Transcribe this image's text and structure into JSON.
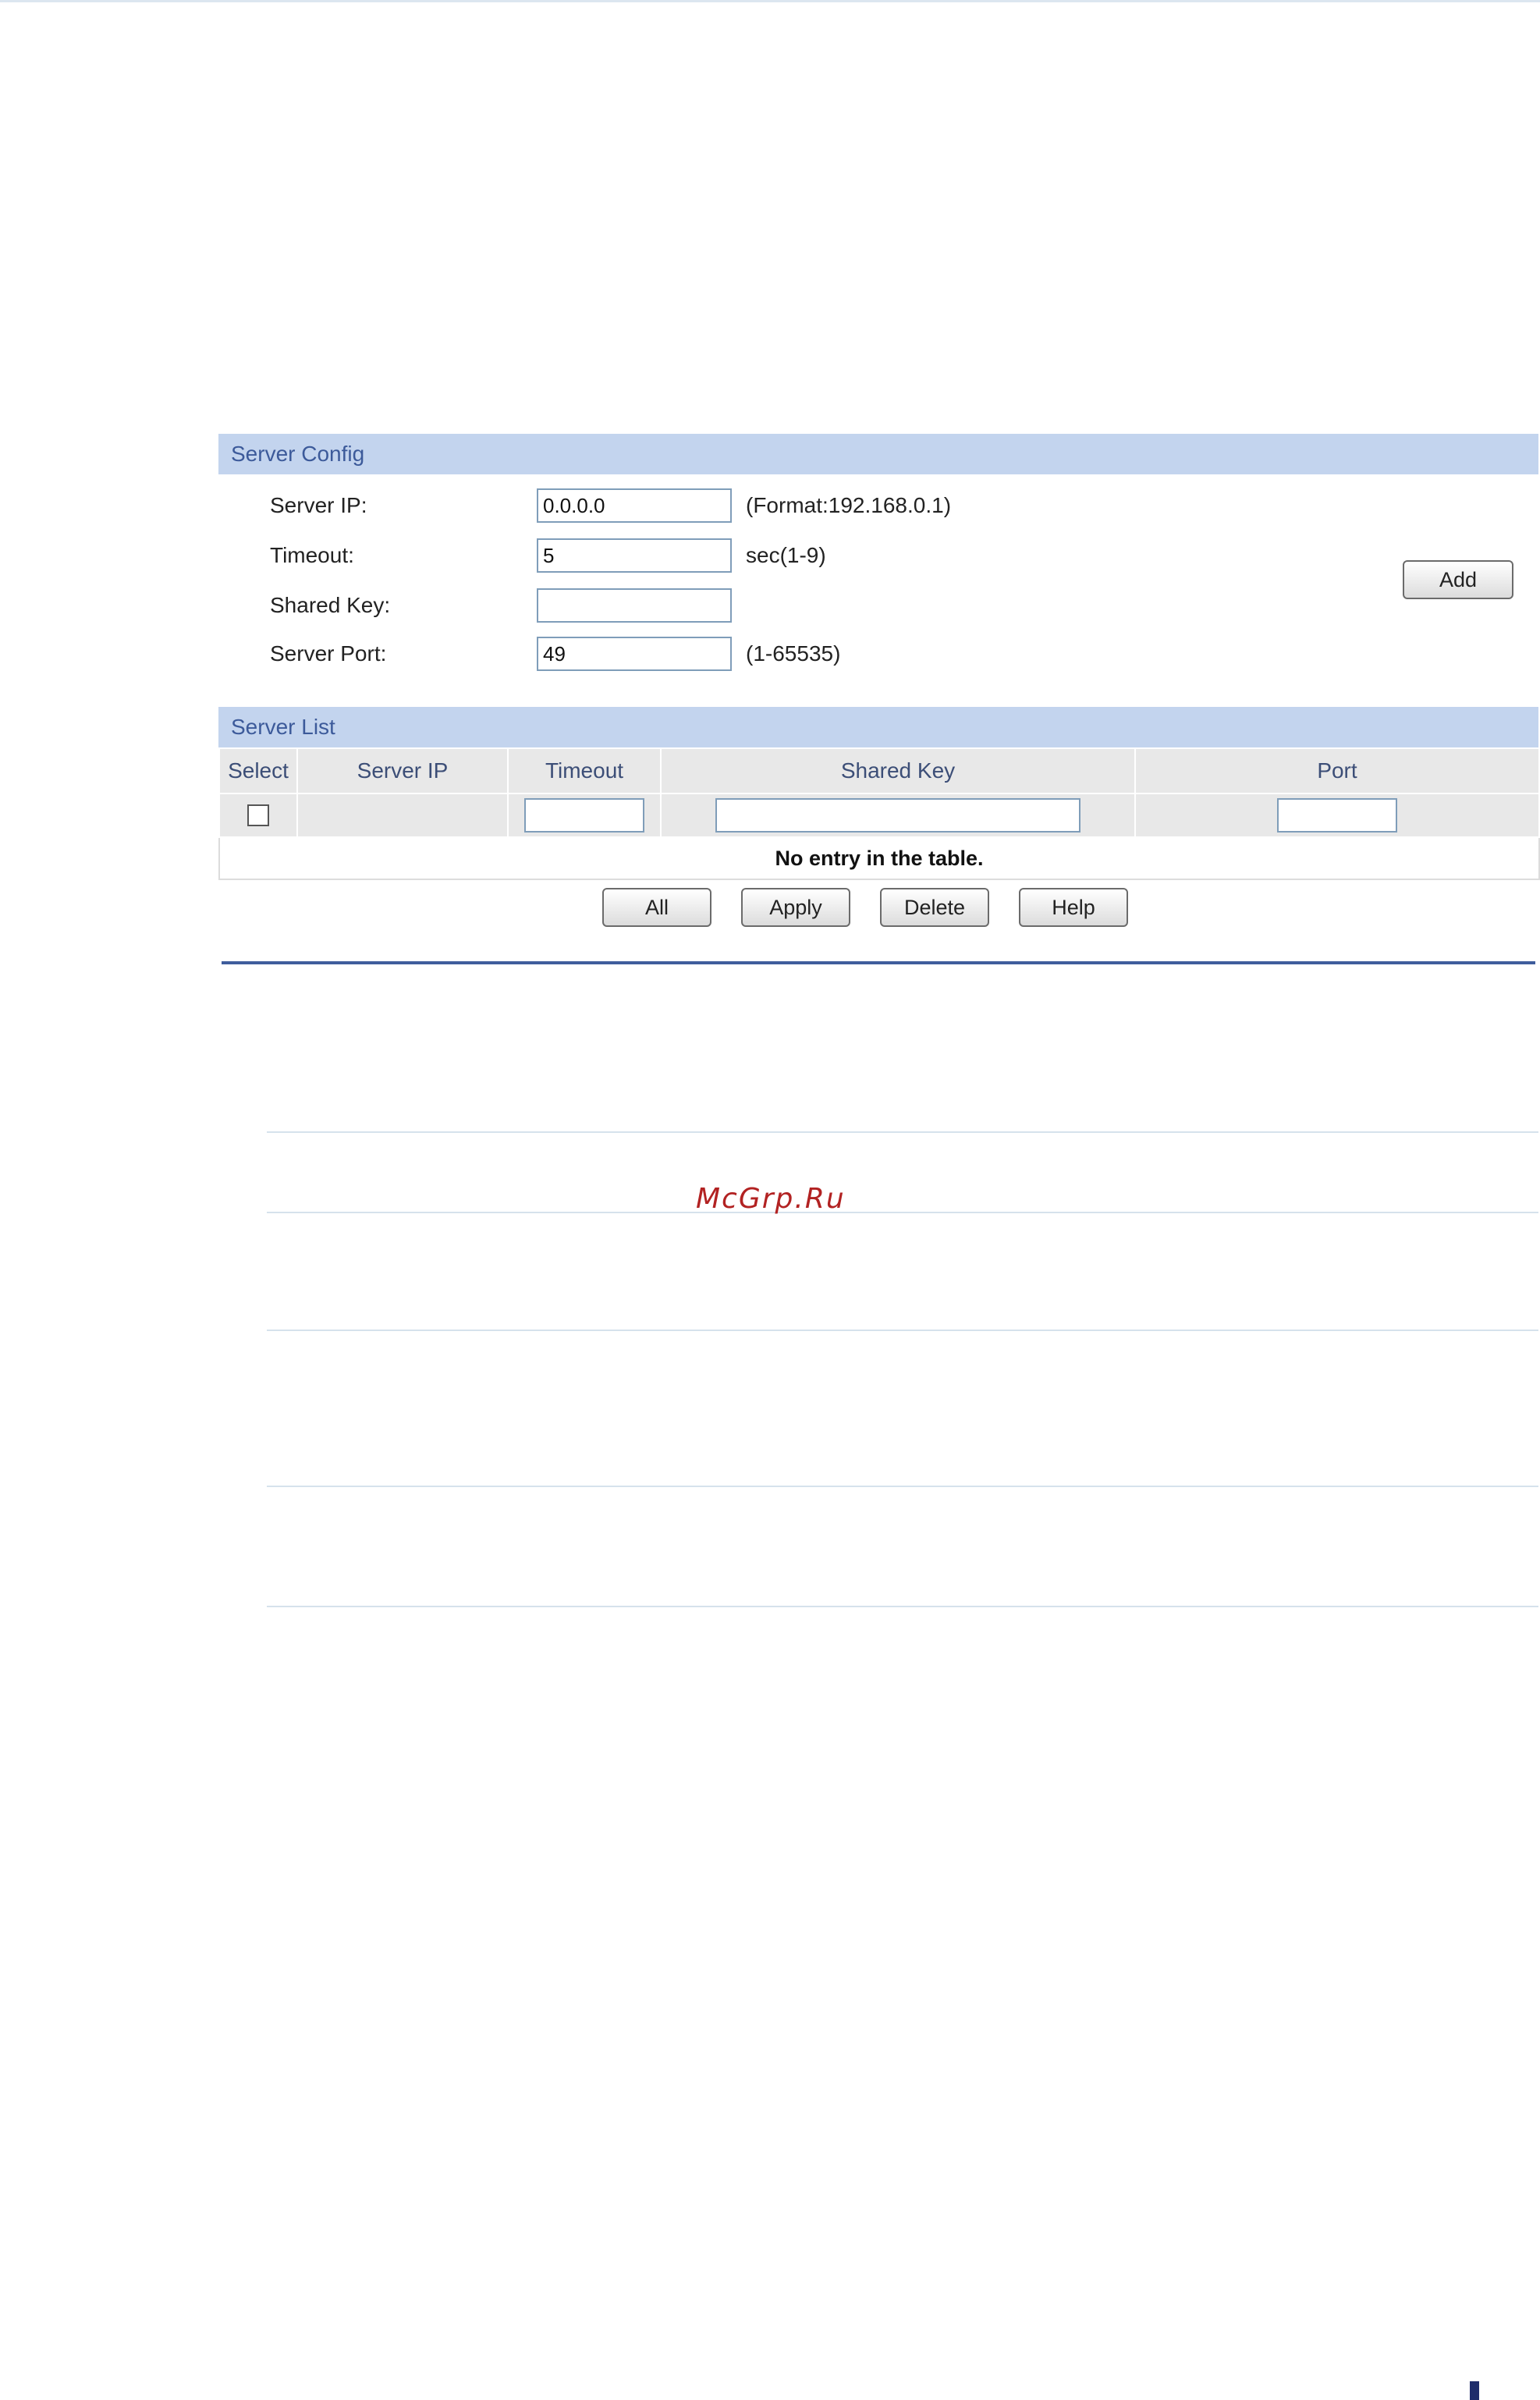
{
  "server_config": {
    "title": "Server Config",
    "fields": [
      {
        "label": "Server IP:",
        "value": "0.0.0.0",
        "hint": "(Format:192.168.0.1)"
      },
      {
        "label": "Timeout:",
        "value": "5",
        "hint": "sec(1-9)"
      },
      {
        "label": "Shared Key:",
        "value": "",
        "hint": ""
      },
      {
        "label": "Server Port:",
        "value": "49",
        "hint": "(1-65535)"
      }
    ],
    "add_label": "Add"
  },
  "server_list": {
    "title": "Server List",
    "columns": [
      "Select",
      "Server IP",
      "Timeout",
      "Shared Key",
      "Port"
    ],
    "empty_message": "No entry in the table."
  },
  "actions": {
    "all_label": "All",
    "apply_label": "Apply",
    "delete_label": "Delete",
    "help_label": "Help"
  },
  "watermark": "McGrp.Ru",
  "colors": {
    "section_bar": "#c3d4ee",
    "section_title": "#3c5a9a",
    "divider": "#3f5d9c",
    "watermark": "#b22222"
  }
}
